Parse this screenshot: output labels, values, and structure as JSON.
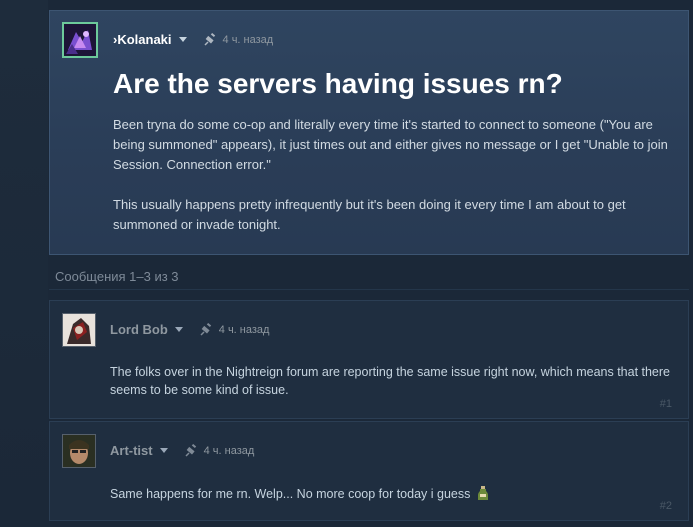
{
  "thread": {
    "author": "›Kolanaki",
    "time": "4 ч. назад",
    "title": "Are the servers having issues rn?",
    "paragraphs": [
      "Been tryna do some co-op and literally every time it's started to connect to someone (\"You are being summoned\" appears), it just times out and either gives no message or I get \"Unable to join Session. Connection error.\"",
      "This usually happens pretty infrequently but it's been doing it every time I am about to get summoned or invade tonight."
    ]
  },
  "messages_count": "Сообщения 1–3 из 3",
  "comments": [
    {
      "author": "Lord Bob",
      "time": "4 ч. назад",
      "text": "The folks over in the Nightreign forum are reporting the same issue right now, which means that there seems to be some kind of issue.",
      "number": "#1"
    },
    {
      "author": "Art-tist",
      "time": "4 ч. назад",
      "text": "Same happens for me rn. Welp... No more coop for today i guess",
      "number": "#2"
    }
  ],
  "icons": {
    "time": "pin-icon",
    "author_menu": "chevron-down-icon",
    "emoticon": "bottle-emoticon-icon"
  },
  "colors": {
    "background": "#1b2838",
    "op_panel": "#2f4560",
    "comment_panel": "#1f2e40",
    "op_avatar_border": "#6dc99b"
  }
}
